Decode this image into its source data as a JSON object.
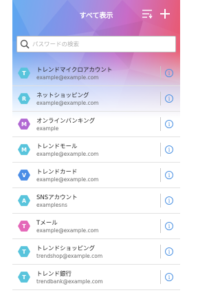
{
  "header": {
    "title": "すべて表示",
    "sort_icon": "sort-list-icon",
    "add_icon": "plus-icon"
  },
  "search": {
    "placeholder": "パスワードの検索",
    "icon": "search-icon"
  },
  "theme": {
    "info_color": "#4a90e2",
    "avatar_cyan": "#58c4dc",
    "avatar_purple": "#b168d3",
    "avatar_blue": "#4a8de6",
    "avatar_pink": "#e467b8"
  },
  "accounts": [
    {
      "initial": "T",
      "name": "トレンドマイクロアカウント",
      "user": "example@example.com",
      "color": "#58c4dc"
    },
    {
      "initial": "R",
      "name": "ネットショッピング",
      "user": "example@example.com",
      "color": "#58c4dc"
    },
    {
      "initial": "M",
      "name": "オンラインバンキング",
      "user": "example",
      "color": "#b168d3"
    },
    {
      "initial": "M",
      "name": "トレンドモール",
      "user": "example@example.com",
      "color": "#58c4dc"
    },
    {
      "initial": "V",
      "name": "トレンドカード",
      "user": "example@example.com",
      "color": "#4a8de6"
    },
    {
      "initial": "A",
      "name": "SNSアカウント",
      "user": "examplesns",
      "color": "#58c4dc"
    },
    {
      "initial": "T",
      "name": "Tメール",
      "user": "example@example.com",
      "color": "#e467b8"
    },
    {
      "initial": "T",
      "name": "トレンドショッピング",
      "user": "trendshop@example.com",
      "color": "#58c4dc"
    },
    {
      "initial": "T",
      "name": "トレンド銀行",
      "user": "trendbank@example.com",
      "color": "#58c4dc"
    }
  ],
  "info_icon": "info-icon",
  "info_glyph": "i"
}
